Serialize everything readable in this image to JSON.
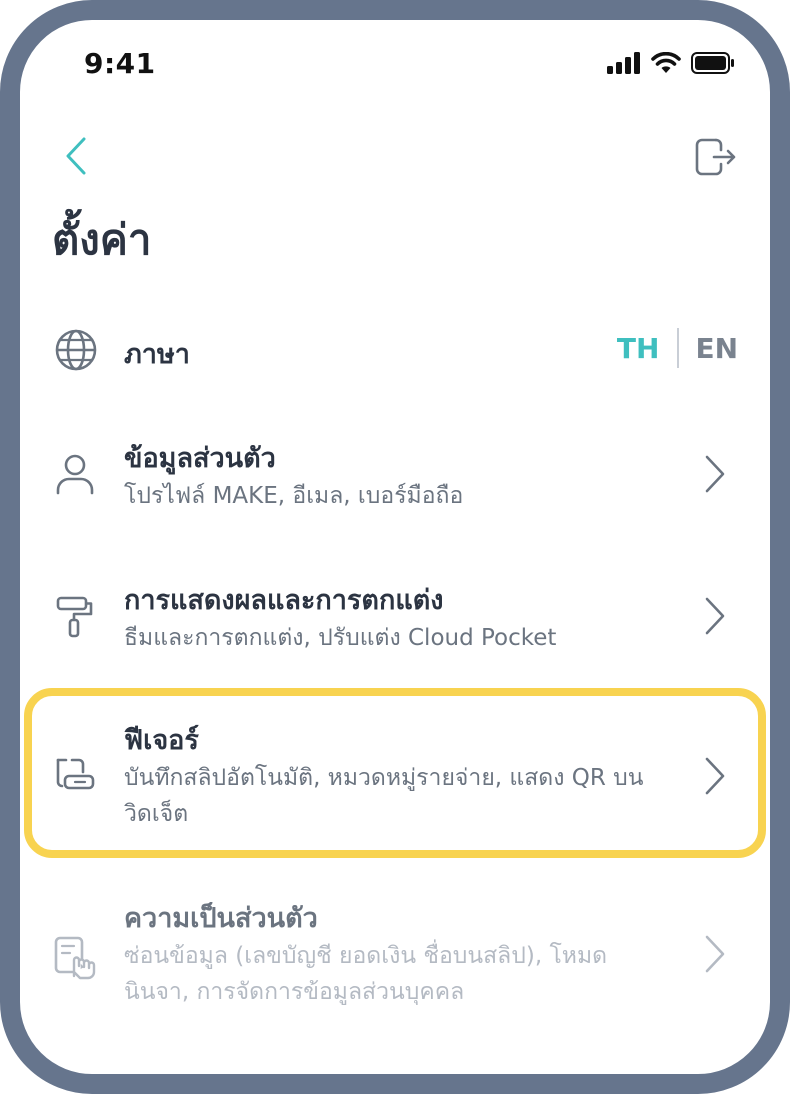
{
  "status_bar": {
    "time": "9:41",
    "icons": [
      "signal-icon",
      "wifi-icon",
      "battery-icon"
    ]
  },
  "header": {
    "back_icon": "chevron-left-icon",
    "exit_icon": "logout-icon",
    "title": "ตั้งค่า"
  },
  "language": {
    "icon": "globe-icon",
    "label": "ภาษา",
    "options": [
      "TH",
      "EN"
    ],
    "selected": "TH"
  },
  "menu": [
    {
      "icon": "user-icon",
      "title": "ข้อมูลส่วนตัว",
      "description": "โปรไฟล์ MAKE, อีเมล, เบอร์มือถือ",
      "enabled": true
    },
    {
      "icon": "paint-roller-icon",
      "title": "การแสดงผลและการตกแต่ง",
      "description": "ธีมและการตกแต่ง, ปรับแต่ง Cloud Pocket",
      "enabled": true
    },
    {
      "icon": "features-icon",
      "title": "ฟีเจอร์",
      "description": "บันทึกสลิปอัตโนมัติ, หมวดหมู่รายจ่าย, แสดง QR บนวิดเจ็ต",
      "enabled": true,
      "highlighted": true
    },
    {
      "icon": "privacy-hand-icon",
      "title": "ความเป็นส่วนตัว",
      "description": "ซ่อนข้อมูล (เลขบัญชี ยอดเงิน ชื่อบนสลิป), โหมดนินจา, การจัดการข้อมูลส่วนบุคคล",
      "enabled": false
    }
  ],
  "colors": {
    "frame": "#66758d",
    "accent": "#3fbfbf",
    "highlight": "#f8d350",
    "text_primary": "#2c3442",
    "text_secondary": "#6b7480",
    "lang_inactive": "#7a838f"
  }
}
